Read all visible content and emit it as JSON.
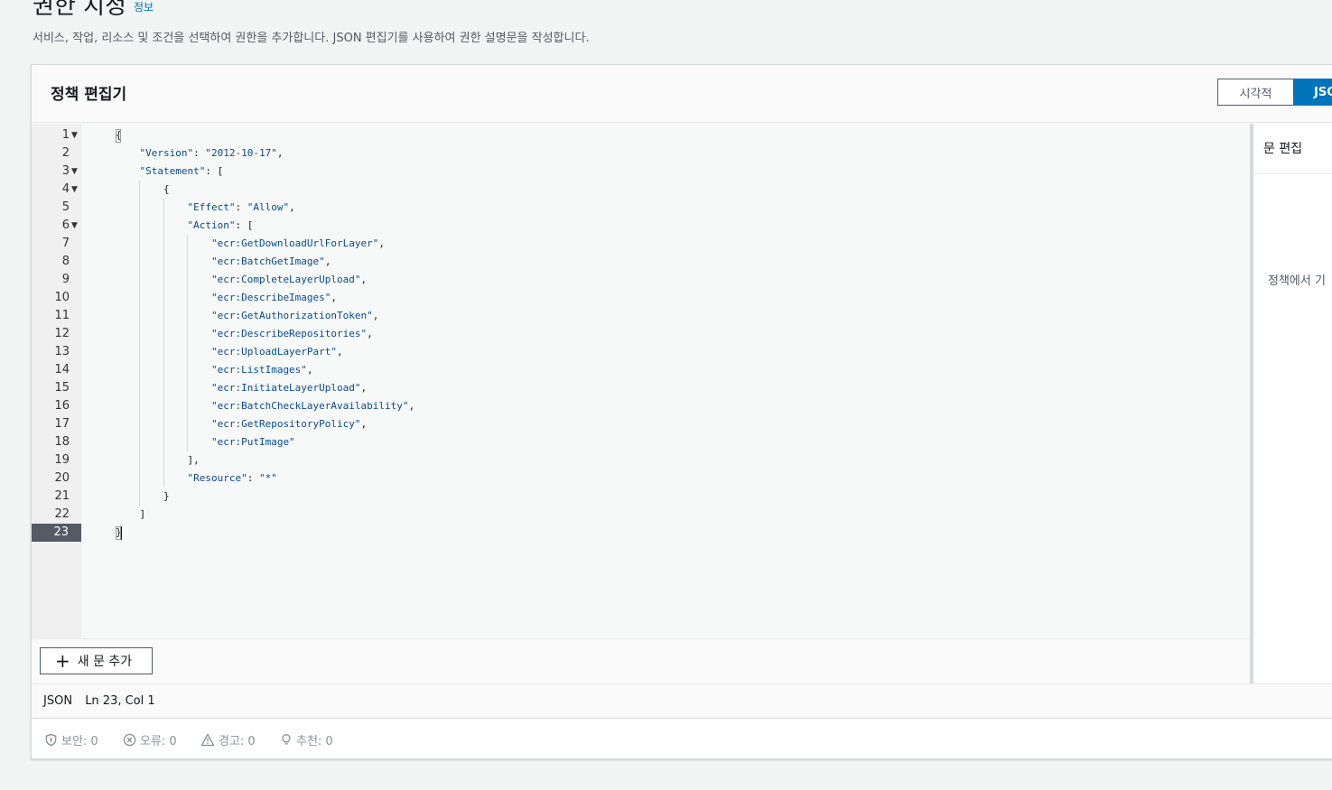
{
  "header": {
    "title": "권한 지정",
    "info_link": "정보",
    "subtitle": "서비스, 작업, 리소스 및 조건을 선택하여 권한을 추가합니다. JSON 편집기를 사용하여 권한 설명문을 작성합니다."
  },
  "policy_editor": {
    "title": "정책 편집기",
    "modes": [
      "시각적",
      "JSON"
    ],
    "selected_mode": "JSON",
    "code_lines": [
      {
        "n": "1",
        "text": "{",
        "fold": true
      },
      {
        "n": "2",
        "text": "    \"Version\": \"2012-10-17\","
      },
      {
        "n": "3",
        "text": "    \"Statement\": [",
        "fold": true
      },
      {
        "n": "4",
        "text": "        {",
        "fold": true
      },
      {
        "n": "5",
        "text": "            \"Effect\": \"Allow\","
      },
      {
        "n": "6",
        "text": "            \"Action\": [",
        "fold": true
      },
      {
        "n": "7",
        "text": "                \"ecr:GetDownloadUrlForLayer\","
      },
      {
        "n": "8",
        "text": "                \"ecr:BatchGetImage\","
      },
      {
        "n": "9",
        "text": "                \"ecr:CompleteLayerUpload\","
      },
      {
        "n": "10",
        "text": "                \"ecr:DescribeImages\","
      },
      {
        "n": "11",
        "text": "                \"ecr:GetAuthorizationToken\","
      },
      {
        "n": "12",
        "text": "                \"ecr:DescribeRepositories\","
      },
      {
        "n": "13",
        "text": "                \"ecr:UploadLayerPart\","
      },
      {
        "n": "14",
        "text": "                \"ecr:ListImages\","
      },
      {
        "n": "15",
        "text": "                \"ecr:InitiateLayerUpload\","
      },
      {
        "n": "16",
        "text": "                \"ecr:BatchCheckLayerAvailability\","
      },
      {
        "n": "17",
        "text": "                \"ecr:GetRepositoryPolicy\","
      },
      {
        "n": "18",
        "text": "                \"ecr:PutImage\""
      },
      {
        "n": "19",
        "text": "            ],"
      },
      {
        "n": "20",
        "text": "            \"Resource\": \"*\""
      },
      {
        "n": "21",
        "text": "        }"
      },
      {
        "n": "22",
        "text": "    ]"
      },
      {
        "n": "23",
        "text": "}",
        "active": true
      }
    ],
    "add_statement_label": "새 문 추가",
    "side_panel": {
      "title": "문 편집",
      "body": "정책에서 기"
    },
    "status": {
      "mode": "JSON",
      "cursor": "Ln 23, Col 1"
    },
    "findings": [
      {
        "icon": "shield-icon",
        "label": "보안: 0"
      },
      {
        "icon": "error-icon",
        "label": "오류: 0"
      },
      {
        "icon": "warning-icon",
        "label": "경고: 0"
      },
      {
        "icon": "lightbulb-icon",
        "label": "추천: 0"
      }
    ]
  }
}
